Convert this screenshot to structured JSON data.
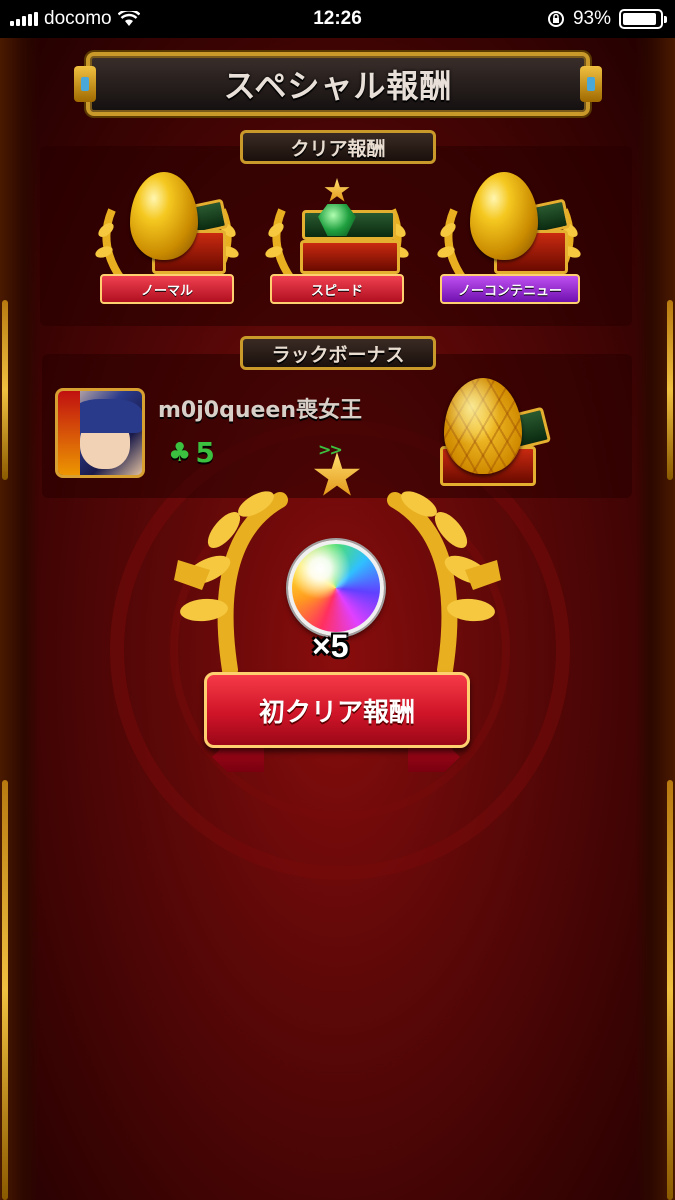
{
  "status_bar": {
    "carrier": "docomo",
    "time": "12:26",
    "battery_percent": "93%",
    "battery_level": 0.93
  },
  "title": "スペシャル報酬",
  "clear_rewards": {
    "label": "クリア報酬",
    "badges": [
      {
        "label": "ノーマル",
        "item": "golden-egg",
        "ribbon_color": "#d01428"
      },
      {
        "label": "スピード",
        "item": "green-gem-chest",
        "ribbon_color": "#d01428"
      },
      {
        "label": "ノーコンテニュー",
        "item": "golden-egg",
        "ribbon_color": "#8a20c0"
      }
    ]
  },
  "luck_bonus": {
    "label": "ラックボーナス",
    "player_name": "m0j0queen喪女王",
    "luck_value": "5",
    "reward_item": "honeycomb-egg"
  },
  "first_clear_reward": {
    "label": "初クリア報酬",
    "item": "rainbow-orb",
    "quantity": "×5"
  },
  "colors": {
    "background": "#5e0808",
    "gold": "#c9992a",
    "luck_green": "#3cc040"
  }
}
